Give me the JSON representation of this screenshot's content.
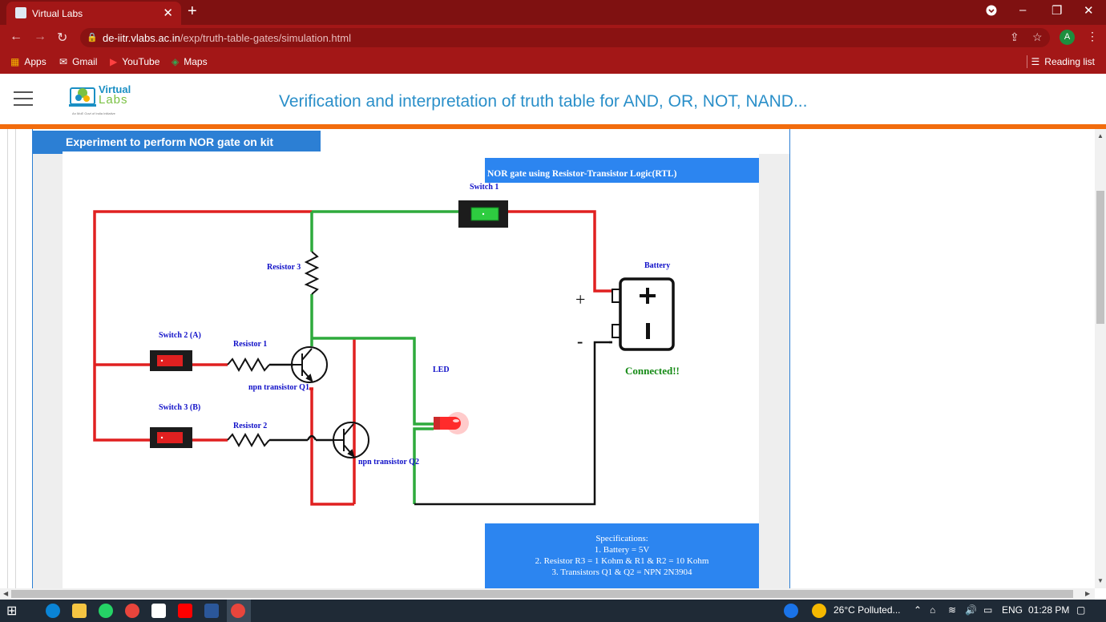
{
  "browser": {
    "tab_title": "Virtual Labs",
    "tab_close": "✕",
    "new_tab": "+",
    "window_controls": [
      "–",
      "❐",
      "✕"
    ],
    "url_host": "de-iitr.vlabs.ac.in",
    "url_path": "/exp/truth-table-gates/simulation.html",
    "profile_initial": "A",
    "bookmarks": [
      {
        "label": "Apps",
        "icon": "apps-grid-icon",
        "color": "#f4b400"
      },
      {
        "label": "Gmail",
        "icon": "gmail-icon",
        "color": "#ffffff"
      },
      {
        "label": "YouTube",
        "icon": "youtube-icon",
        "color": "#ff0000"
      },
      {
        "label": "Maps",
        "icon": "maps-icon",
        "color": "#34a853"
      }
    ],
    "reading_list": "Reading list"
  },
  "site": {
    "logo_top": "Virtual",
    "logo_bottom": "Labs",
    "logo_sub": "An MoE Govt of India Initiative",
    "page_title": "Verification and interpretation of truth table for AND, OR, NOT, NAND...",
    "accent_orange": "#f26c0d",
    "accent_blue": "#2c7fd4"
  },
  "experiment": {
    "title": "Experiment to perform NOR gate on kit",
    "circuit_title": "NOR gate using Resistor-Transistor Logic(RTL)",
    "labels": {
      "switch1": "Switch 1",
      "switch2": "Switch 2 (A)",
      "switch3": "Switch 3 (B)",
      "resistor1": "Resistor 1",
      "resistor2": "Resistor 2",
      "resistor3": "Resistor 3",
      "q1": "npn transistor Q1",
      "q2": "npn transistor Q2",
      "led": "LED",
      "battery": "Battery",
      "plus": "+",
      "minus": "-",
      "status": "Connected!!"
    },
    "states": {
      "switch1": "on",
      "switch2": "off",
      "switch3": "off",
      "led": "on"
    },
    "specifications": {
      "heading": "Specifications:",
      "lines": [
        "1. Battery = 5V",
        "2. Resistor R3 = 1 Kohm & R1 & R2 = 10 Kohm",
        "3. Transistors Q1 & Q2 = NPN 2N3904"
      ]
    }
  },
  "taskbar": {
    "weather": "26°C  Polluted...",
    "lang": "ENG",
    "time": "01:28 PM"
  }
}
